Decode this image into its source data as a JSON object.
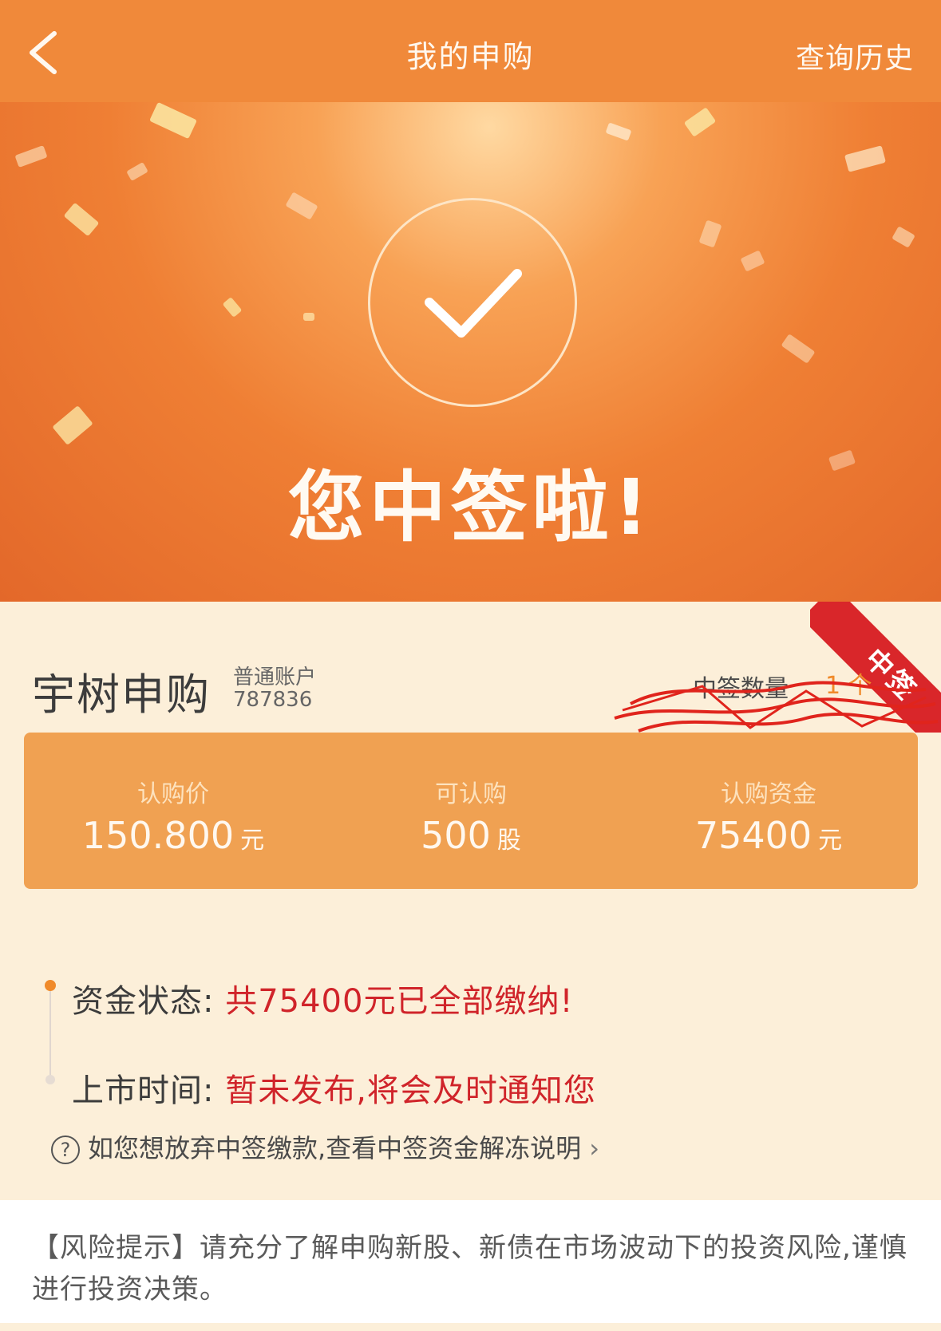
{
  "nav": {
    "title": "我的申购",
    "history": "查询历史"
  },
  "hero": {
    "title": "您中签啦!"
  },
  "ribbon": {
    "label": "中签"
  },
  "stock": {
    "name": "宇树申购",
    "account_type": "普通账户",
    "account_no": "787836",
    "win_label": "中签数量",
    "win_value": "1 个"
  },
  "subscription": {
    "price_label": "认购价",
    "price_value": "150.800",
    "price_unit": "元",
    "qty_label": "可认购",
    "qty_value": "500",
    "qty_unit": "股",
    "fund_label": "认购资金",
    "fund_value": "75400",
    "fund_unit": "元"
  },
  "status": {
    "fund_label": "资金状态:",
    "fund_value": "共75400元已全部缴纳!",
    "listing_label": "上市时间:",
    "listing_value": "暂未发布,将会及时通知您",
    "help_text": "如您想放弃中签缴款,查看中签资金解冻说明",
    "help_icon": "?"
  },
  "risk": {
    "text": "【风险提示】请充分了解申购新股、新债在市场波动下的投资风险,谨慎进行投资决策。"
  },
  "colors": {
    "nav": "#f0893a",
    "accent": "#f08a2a",
    "highlight_red": "#d0242a",
    "card": "#f0a152",
    "page_bg": "#fcefd9"
  }
}
